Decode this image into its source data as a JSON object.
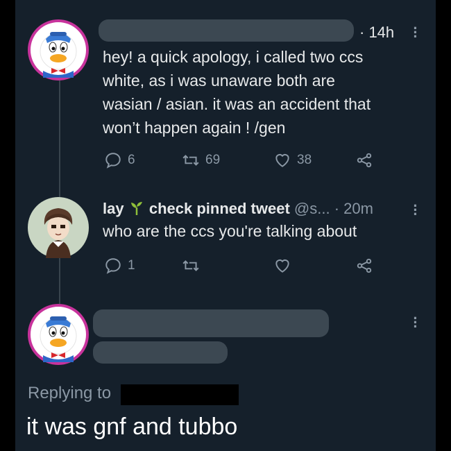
{
  "tweets": [
    {
      "time": "· 14h",
      "text_lines": [
        "hey! a quick apology, i called two ccs",
        "white, as i was unaware both are",
        "wasian / asian. it was an accident that",
        "won’t happen again ! /gen"
      ],
      "replies": "6",
      "retweets": "69",
      "likes": "38"
    },
    {
      "name": "lay",
      "name_suffix": "check pinned tweet",
      "handle": "@s...",
      "time": "· 20m",
      "text": "who are the ccs you're talking about",
      "replies": "1"
    }
  ],
  "compose": {
    "replying_label": "Replying to",
    "text": "it was gnf and tubbo"
  },
  "icons": {
    "more": "more-vertical-icon",
    "reply": "reply-bubble-icon",
    "retweet": "retweet-icon",
    "like": "heart-icon",
    "share": "share-icon",
    "sprout": "sprout-emoji"
  },
  "colors": {
    "background": "#15202b",
    "text": "#e7e9ea",
    "muted": "#8b98a5",
    "avatar_ring": "#c8339c",
    "sprout": "#8fbf3a"
  }
}
